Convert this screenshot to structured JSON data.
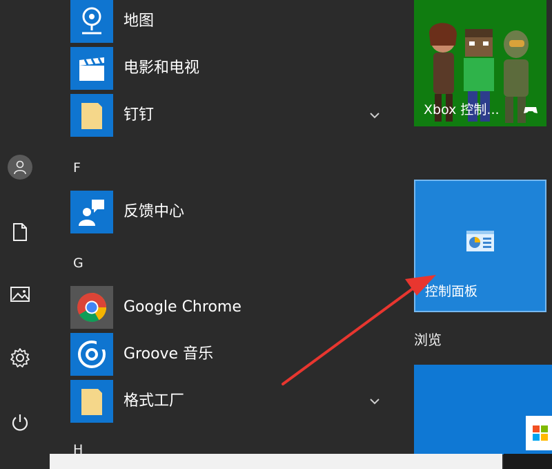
{
  "apps": {
    "maps_label": "地图",
    "movies_label": "电影和电视",
    "dingtalk_label": "钉钉",
    "feedback_label": "反馈中心",
    "chrome_label": "Google Chrome",
    "groove_label": "Groove 音乐",
    "geshi_label": "格式工厂"
  },
  "letters": {
    "f": "F",
    "g": "G",
    "h": "H"
  },
  "tiles": {
    "xbox_label": "Xbox 控制...",
    "control_panel_label": "控制面板",
    "group_label": "浏览"
  },
  "colors": {
    "background": "#2b2b2b",
    "tile_blue": "#0f75d0",
    "xbox_green": "#107c10",
    "arrow_red": "#e8362f"
  },
  "icons": {
    "rail": [
      "user-icon",
      "document-icon",
      "pictures-icon",
      "settings-icon",
      "power-icon"
    ]
  }
}
